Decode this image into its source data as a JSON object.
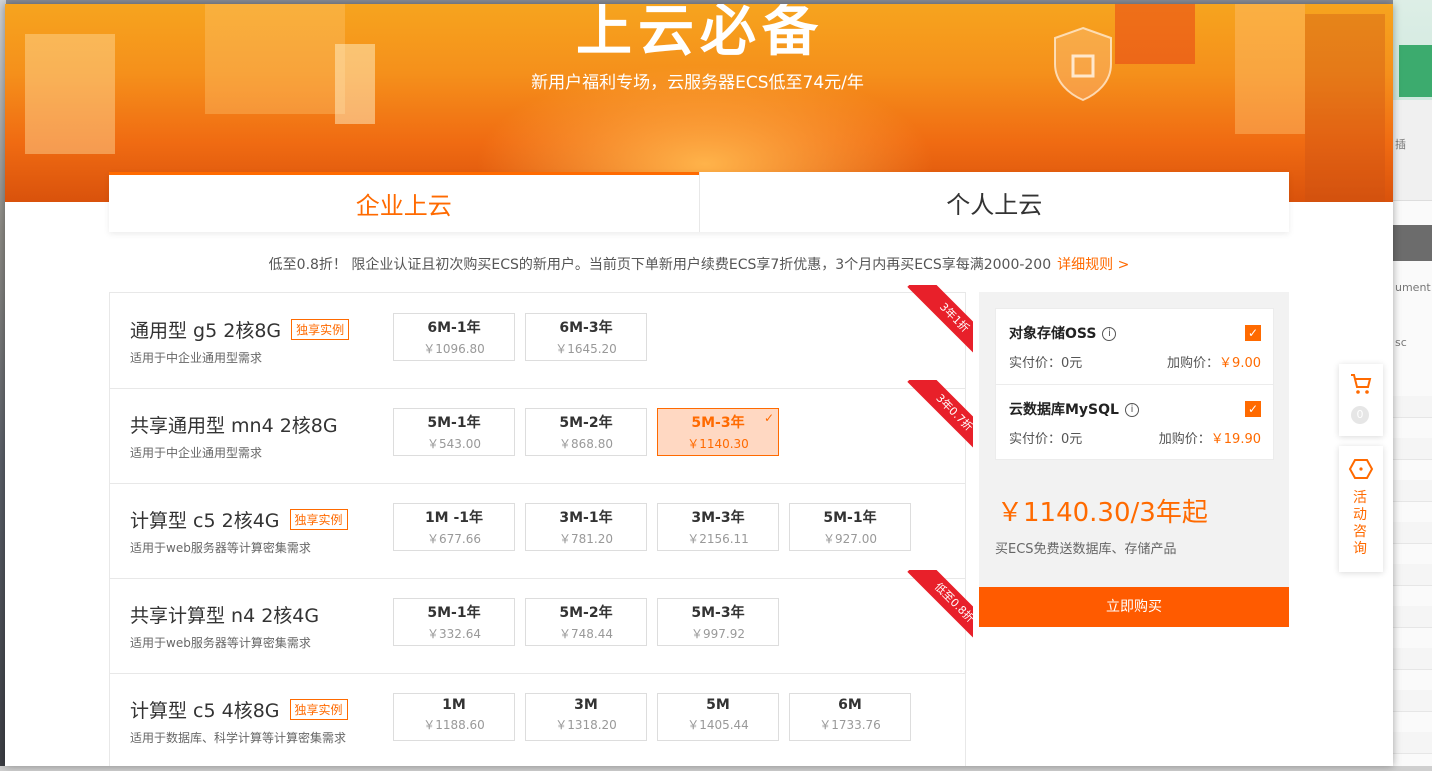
{
  "hero": {
    "title": "上云必备",
    "subtitle": "新用户福利专场，云服务器ECS低至74元/年"
  },
  "tabs": [
    {
      "label": "企业上云",
      "active": true
    },
    {
      "label": "个人上云",
      "active": false
    }
  ],
  "notice": {
    "text": "低至0.8折！ 限企业认证且初次购买ECS的新用户。当前页下单新用户续费ECS享7折优惠，3个月内再买ECS享每满2000-200",
    "link": "详细规则 >"
  },
  "products": [
    {
      "name": "通用型 g5 2核8G",
      "badge": "独享实例",
      "desc": "适用于中企业通用型需求",
      "ribbon": "3年1折",
      "options": [
        {
          "label": "6M-1年",
          "price": "￥1096.80"
        },
        {
          "label": "6M-3年",
          "price": "￥1645.20"
        }
      ]
    },
    {
      "name": "共享通用型 mn4 2核8G",
      "badge": "",
      "desc": "适用于中企业通用型需求",
      "ribbon": "3年0.7折",
      "options": [
        {
          "label": "5M-1年",
          "price": "￥543.00"
        },
        {
          "label": "5M-2年",
          "price": "￥868.80"
        },
        {
          "label": "5M-3年",
          "price": "￥1140.30",
          "selected": true
        }
      ]
    },
    {
      "name": "计算型 c5 2核4G",
      "badge": "独享实例",
      "desc": "适用于web服务器等计算密集需求",
      "ribbon": "",
      "options": [
        {
          "label": "1M -1年",
          "price": "￥677.66"
        },
        {
          "label": "3M-1年",
          "price": "￥781.20"
        },
        {
          "label": "3M-3年",
          "price": "￥2156.11"
        },
        {
          "label": "5M-1年",
          "price": "￥927.00"
        }
      ]
    },
    {
      "name": "共享计算型 n4 2核4G",
      "badge": "",
      "desc": "适用于web服务器等计算密集需求",
      "ribbon": "低至0.8折",
      "options": [
        {
          "label": "5M-1年",
          "price": "￥332.64"
        },
        {
          "label": "5M-2年",
          "price": "￥748.44"
        },
        {
          "label": "5M-3年",
          "price": "￥997.92"
        }
      ]
    },
    {
      "name": "计算型 c5 4核8G",
      "badge": "独享实例",
      "desc": "适用于数据库、科学计算等计算密集需求",
      "ribbon": "",
      "options": [
        {
          "label": "1M",
          "price": "￥1188.60"
        },
        {
          "label": "3M",
          "price": "￥1318.20"
        },
        {
          "label": "5M",
          "price": "￥1405.44"
        },
        {
          "label": "6M",
          "price": "￥1733.76"
        }
      ]
    }
  ],
  "summary": {
    "addons": [
      {
        "name": "对象存储OSS",
        "paid": "实付价：0元",
        "add_label": "加购价：",
        "add_price": "￥9.00",
        "checked": true
      },
      {
        "name": "云数据库MySQL",
        "paid": "实付价：0元",
        "add_label": "加购价：",
        "add_price": "￥19.90",
        "checked": true
      }
    ],
    "total": "￥1140.30/3年起",
    "total_sub": "买ECS免费送数据库、存储产品",
    "buy_label": "立即购买"
  },
  "side": {
    "cart_count": "0",
    "consult_label": "活动咨询"
  },
  "background_app": {
    "texts": [
      "插",
      "ument",
      "sc"
    ]
  },
  "colors": {
    "accent": "#ff6a00",
    "ribbon": "#e8202a"
  }
}
